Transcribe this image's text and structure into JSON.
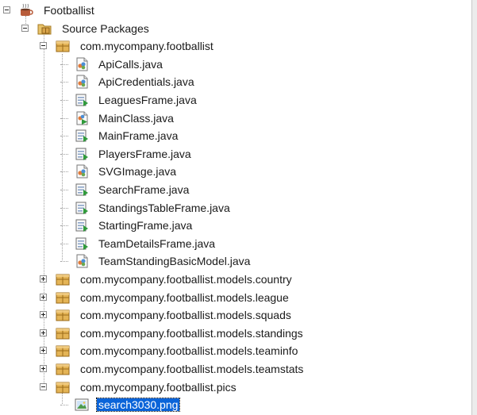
{
  "project": {
    "name": "Footballist",
    "source_packages": "Source Packages"
  },
  "main_package": {
    "name": "com.mycompany.footballist",
    "files": [
      {
        "label": "ApiCalls.java",
        "type": "class"
      },
      {
        "label": "ApiCredentials.java",
        "type": "class"
      },
      {
        "label": "LeaguesFrame.java",
        "type": "form"
      },
      {
        "label": "MainClass.java",
        "type": "main"
      },
      {
        "label": "MainFrame.java",
        "type": "form"
      },
      {
        "label": "PlayersFrame.java",
        "type": "form"
      },
      {
        "label": "SVGImage.java",
        "type": "class"
      },
      {
        "label": "SearchFrame.java",
        "type": "form"
      },
      {
        "label": "StandingsTableFrame.java",
        "type": "form"
      },
      {
        "label": "StartingFrame.java",
        "type": "form"
      },
      {
        "label": "TeamDetailsFrame.java",
        "type": "form"
      },
      {
        "label": "TeamStandingBasicModel.java",
        "type": "class"
      }
    ]
  },
  "collapsed_packages": [
    "com.mycompany.footballist.models.country",
    "com.mycompany.footballist.models.league",
    "com.mycompany.footballist.models.squads",
    "com.mycompany.footballist.models.standings",
    "com.mycompany.footballist.models.teaminfo",
    "com.mycompany.footballist.models.teamstats"
  ],
  "pics_package": {
    "name": "com.mycompany.footballist.pics",
    "files": [
      {
        "label": "search3030.png",
        "type": "image",
        "selected": true
      }
    ]
  },
  "colors": {
    "selection": "#0a64d9",
    "package": "#d9a441",
    "tree_lines": "#a0a0a0"
  }
}
